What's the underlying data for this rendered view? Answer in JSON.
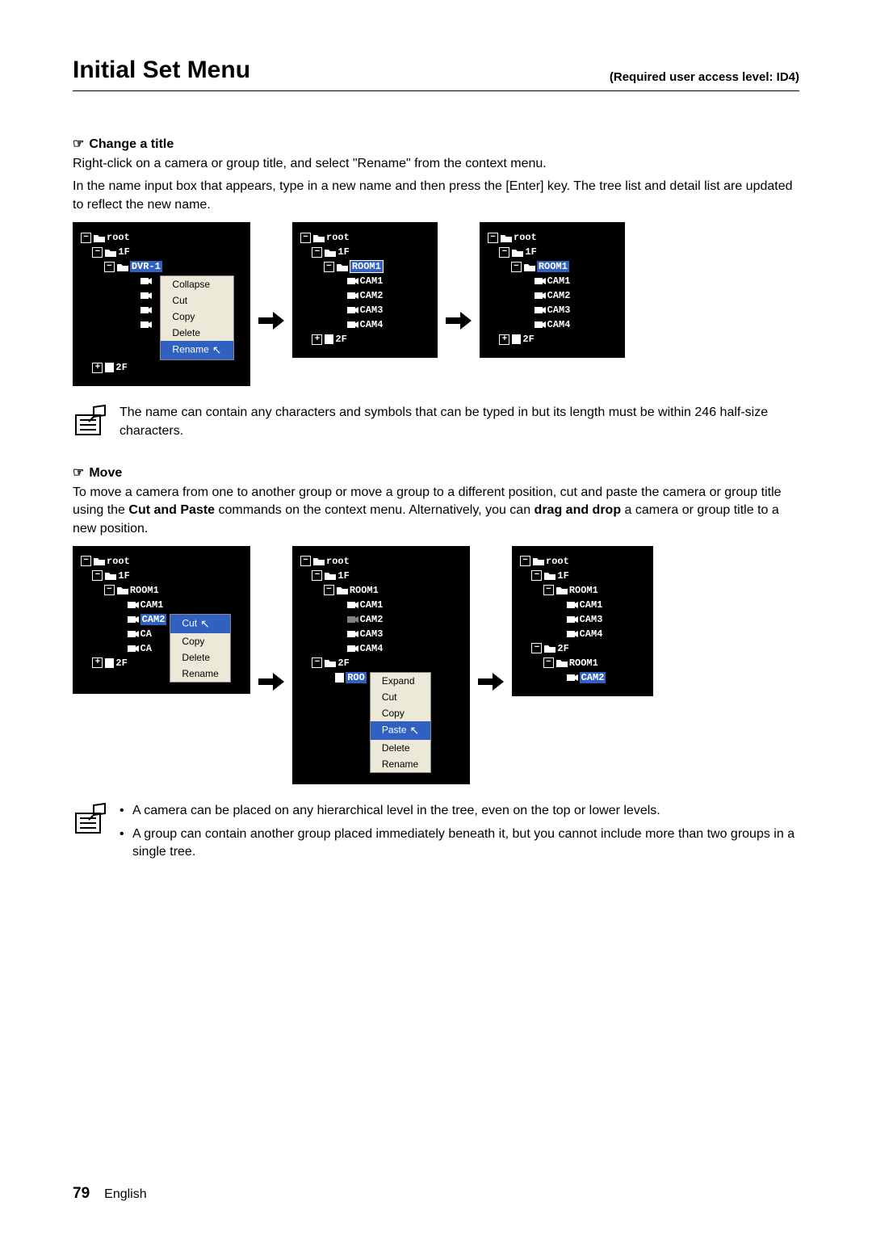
{
  "header": {
    "title": "Initial Set Menu",
    "access_level": "(Required user access level: ID4)"
  },
  "sections": {
    "change_title": {
      "heading": "Change a title",
      "p1": "Right-click on a camera or group title, and select \"Rename\" from the context menu.",
      "p2": "In the name input box that appears, type in a new name and then press the [Enter] key. The tree list and detail list are updated to reflect the new name."
    },
    "move": {
      "heading": "Move",
      "p1_a": "To move a camera from one to another group or move a group to a different position, cut and paste the camera or group title using the ",
      "p1_bold1": "Cut and Paste",
      "p1_b": " commands on the context menu. Alternatively, you can ",
      "p1_bold2": "drag and drop",
      "p1_c": " a camera or group title to a new position."
    }
  },
  "fig1": {
    "box1": {
      "root": "root",
      "f1": "1F",
      "sel": "DVR-1",
      "f2": "2F",
      "menu": [
        "Collapse",
        "Cut",
        "Copy",
        "Delete",
        "Rename"
      ],
      "menu_sel": "Rename"
    },
    "box2": {
      "root": "root",
      "f1": "1F",
      "sel": "ROOM1",
      "items": [
        "CAM1",
        "CAM2",
        "CAM3",
        "CAM4"
      ],
      "f2": "2F"
    },
    "box3": {
      "root": "root",
      "f1": "1F",
      "sel": "ROOM1",
      "items": [
        "CAM1",
        "CAM2",
        "CAM3",
        "CAM4"
      ],
      "f2": "2F"
    }
  },
  "fig2": {
    "box1": {
      "root": "root",
      "f1": "1F",
      "room": "ROOM1",
      "items": [
        "CAM1",
        "CA",
        "CA",
        "CA"
      ],
      "sel": "CAM2",
      "f2": "2F",
      "menu": [
        "Cut",
        "Copy",
        "Delete",
        "Rename"
      ],
      "menu_sel": "Cut"
    },
    "box2": {
      "root": "root",
      "f1": "1F",
      "room": "ROOM1",
      "items": [
        "CAM1",
        "CAM2",
        "CAM3",
        "CAM4"
      ],
      "f2": "2F",
      "sel": "ROO",
      "menu": [
        "Expand",
        "Cut",
        "Copy",
        "Paste",
        "Delete",
        "Rename"
      ],
      "menu_sel": "Paste"
    },
    "box3": {
      "root": "root",
      "f1": "1F",
      "room": "ROOM1",
      "items1": [
        "CAM1",
        "CAM3",
        "CAM4"
      ],
      "f2": "2F",
      "room2": "ROOM1",
      "sel": "CAM2"
    }
  },
  "notes": {
    "n1": "The name can contain any characters and symbols that can be typed in but its length must be within 246 half-size characters.",
    "n2a": "A camera can be placed on any hierarchical level in the tree, even on the top or lower levels.",
    "n2b": "A group can contain another group placed immediately beneath it, but you cannot include more than two groups in a single tree."
  },
  "footer": {
    "page": "79",
    "lang": "English"
  }
}
